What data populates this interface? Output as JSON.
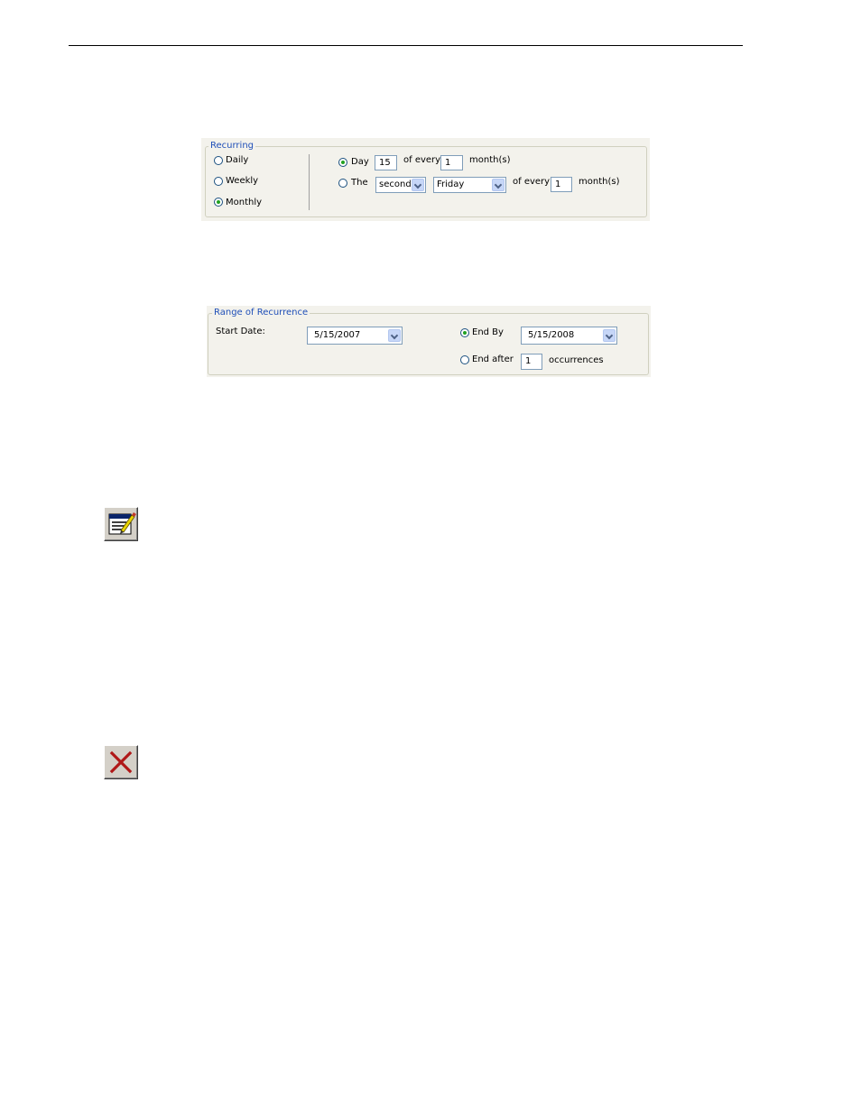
{
  "recurring": {
    "legend": "Recurring",
    "options": [
      {
        "label": "Daily",
        "checked": false
      },
      {
        "label": "Weekly",
        "checked": false
      },
      {
        "label": "Monthly",
        "checked": true
      }
    ],
    "day_row": {
      "radio_label": "Day",
      "checked": true,
      "day_value": "15",
      "of_every_label": "of every",
      "months_value": "1",
      "months_label": "month(s)"
    },
    "the_row": {
      "radio_label": "The",
      "checked": false,
      "ordinal_value": "second",
      "weekday_value": "Friday",
      "of_every_label": "of every",
      "months_value": "1",
      "months_label": "month(s)"
    }
  },
  "range": {
    "legend": "Range of Recurrence",
    "start_label": "Start Date:",
    "start_value": "5/15/2007",
    "end_by_label": "End By",
    "end_by_checked": true,
    "end_by_value": "5/15/2008",
    "end_after_label": "End after",
    "end_after_checked": false,
    "occurrences_value": "1",
    "occurrences_label": "occurrences"
  },
  "icons": {
    "edit": "edit-schedule-icon",
    "delete": "delete-x-icon"
  }
}
